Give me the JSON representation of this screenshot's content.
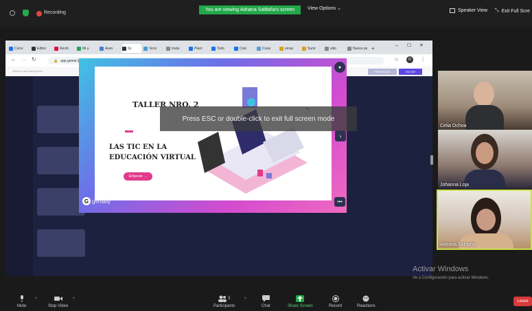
{
  "topbar": {
    "recording_label": "Recording",
    "viewing_banner": "You are viewing Adriana Saldaña's screen",
    "view_options": "View Options",
    "speaker_view": "Speaker View",
    "exit_fullscreen": "Exit Full Scre"
  },
  "browser": {
    "tabs": [
      "Corre",
      "Editor",
      "Recib",
      "Mi u",
      "Aven",
      "Sc",
      "Versi",
      "tradu",
      "Plant",
      "Todo",
      "Colo",
      "Crear",
      "emaz",
      "Sumr",
      "sitio",
      "Nueva pe"
    ],
    "url": "app.genial.ly/editor/6010deecaaaa740d26ae417f"
  },
  "genially": {
    "hint": "Sitúa en una vista previa",
    "present_btn": "PRESENTAR",
    "edit_btn": "EDITAR",
    "logo": "genially"
  },
  "slide": {
    "title": "TALLER NRO. 2",
    "subtitle_line1": "LAS TIC EN LA",
    "subtitle_line2": "EDUCACIÓN VIRTUAL",
    "start_btn": "Empezar →"
  },
  "esc_message": "Press ESC or double-click to exit full screen mode",
  "participants": [
    {
      "name": "Celia Ochoa"
    },
    {
      "name": "Johanna Loja"
    },
    {
      "name": "Adriana Saldaña"
    }
  ],
  "watermark": {
    "line1": "Activar Windows",
    "line2": "Ve a Configuración para activar Windows."
  },
  "toolbar": {
    "mute": "Mute",
    "stop_video": "Stop Video",
    "participants": "Participants",
    "participants_count": "3",
    "chat": "Chat",
    "share_screen": "Share Screen",
    "record": "Record",
    "reactions": "Reactions",
    "leave": "Leave"
  },
  "colors": {
    "share_green": "#23a84a",
    "leave_red": "#d93a3a",
    "active_speaker": "#c9e04b",
    "genially_purple": "#5a48e0"
  }
}
